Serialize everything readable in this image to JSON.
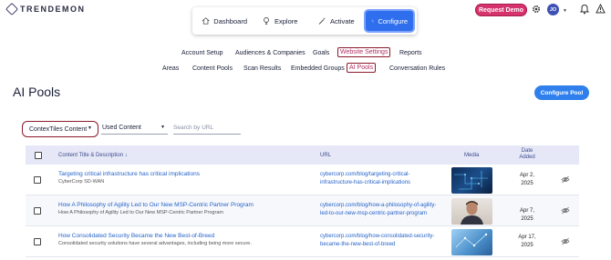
{
  "app": {
    "logo_text": "TRENDEMON"
  },
  "topbar": {
    "request_demo": "Request Demo",
    "avatar_initials": "JO",
    "icons": [
      "gear-icon",
      "bell-icon",
      "warning-icon"
    ]
  },
  "modes": [
    {
      "label": "Dashboard",
      "icon": "home-icon",
      "active": false
    },
    {
      "label": "Explore",
      "icon": "lightbulb-icon",
      "active": false
    },
    {
      "label": "Activate",
      "icon": "magic-wand-icon",
      "active": false
    },
    {
      "label": "Configure",
      "icon": "gears-icon",
      "active": true
    }
  ],
  "nav_primary": [
    "Account Setup",
    "Audiences & Companies",
    "Goals",
    "Website Settings",
    "Reports"
  ],
  "nav_secondary": [
    "Areas",
    "Content Pools",
    "Scan Results",
    "Embedded Groups",
    "AI Pools",
    "Conversation Rules"
  ],
  "page": {
    "title": "AI Pools",
    "configure_button": "Configure Pool"
  },
  "filters": {
    "content_type": "ContexTiles Content",
    "used": "Used Content",
    "search_placeholder": "Search by URL"
  },
  "table": {
    "headers": {
      "title": "Content Title & Description",
      "sort_arrow": "↓",
      "url": "URL",
      "media": "Media",
      "date": "Date Added"
    },
    "rows": [
      {
        "title": "Targeting critical infrastructure has critical implications",
        "description": "CyberCorp SD-WAN",
        "url": "cybercorp.com/blog/targeting-critical-infrastructure-has-critical-implications",
        "date": "Apr 2, 2025",
        "media_color": "#1c4e8a"
      },
      {
        "title": "How A Philosophy of Agility Led to Our New MSP-Centric Partner Program",
        "description": "How A Philosophy of Agility Led to Our New MSP-Centric Partner Program",
        "url": "cybercorp.com/blog/how-a-philosophy-of-agility-led-to-our-new-msp-centric-partner-program",
        "date": "Apr 7, 2025",
        "media_color": "#5b4a3e"
      },
      {
        "title": "How Consolidated Security Became the New Best-of-Breed",
        "description": "Consolidated security solutions have several advantages, including being more secure.",
        "url": "cybercorp.com/blog/how-consolidated-security-became-the-new-best-of-breed",
        "date": "Apr 17, 2025",
        "media_color": "#4a8fc9"
      }
    ]
  }
}
